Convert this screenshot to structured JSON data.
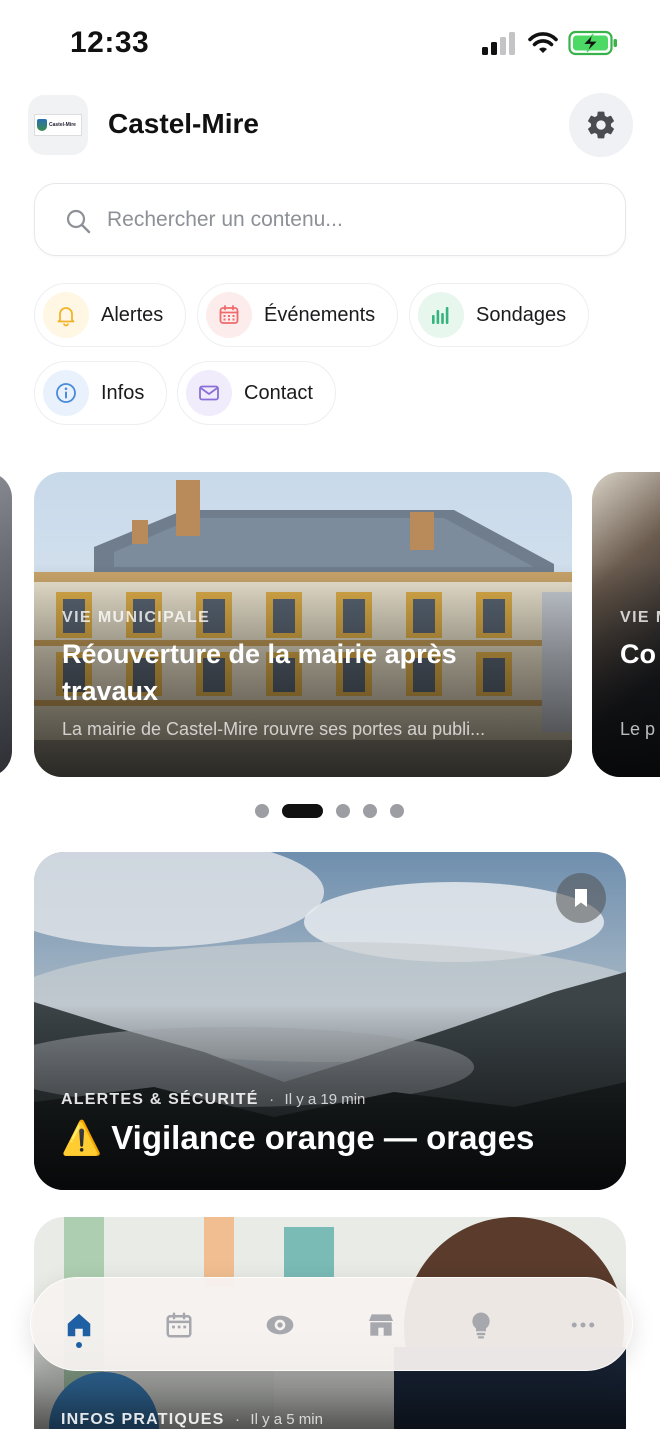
{
  "status_bar": {
    "time": "12:33"
  },
  "header": {
    "logo_text": "Castel-Mire",
    "title": "Castel-Mire"
  },
  "search": {
    "placeholder": "Rechercher un contenu..."
  },
  "quick_links": [
    {
      "label": "Alertes",
      "icon": "bell-icon",
      "color": "#f2b32b"
    },
    {
      "label": "Événements",
      "icon": "calendar-icon",
      "color": "#ef6b6b"
    },
    {
      "label": "Sondages",
      "icon": "bar-chart-icon",
      "color": "#36b37e"
    },
    {
      "label": "Infos",
      "icon": "info-icon",
      "color": "#4a8ad8"
    },
    {
      "label": "Contact",
      "icon": "mail-icon",
      "color": "#8a6fd8"
    }
  ],
  "carousel": {
    "slides": [
      {
        "category": "VIE MUNICIPALE",
        "title": "Réouverture de la mairie après travaux",
        "excerpt": "La mairie de Castel-Mire rouvre ses portes au publi..."
      },
      {
        "category": "VIE M",
        "title": "Co",
        "excerpt": "Le p"
      }
    ],
    "dot_count": 5,
    "active_index": 1
  },
  "feed": [
    {
      "category": "ALERTES & SÉCURITÉ",
      "separator": "·",
      "time": "Il y a 19 min",
      "title": "⚠️ Vigilance orange — orages"
    },
    {
      "category": "INFOS PRATIQUES",
      "separator": "·",
      "time": "Il y a 5 min",
      "title": ""
    }
  ],
  "tab_bar": [
    {
      "icon": "home-icon",
      "active": true
    },
    {
      "icon": "calendar-icon"
    },
    {
      "icon": "eye-icon"
    },
    {
      "icon": "store-icon"
    },
    {
      "icon": "lightbulb-icon"
    },
    {
      "icon": "more-icon"
    }
  ],
  "colors": {
    "accent": "#1f5fa3",
    "tab_inactive": "#a6a8ad"
  }
}
